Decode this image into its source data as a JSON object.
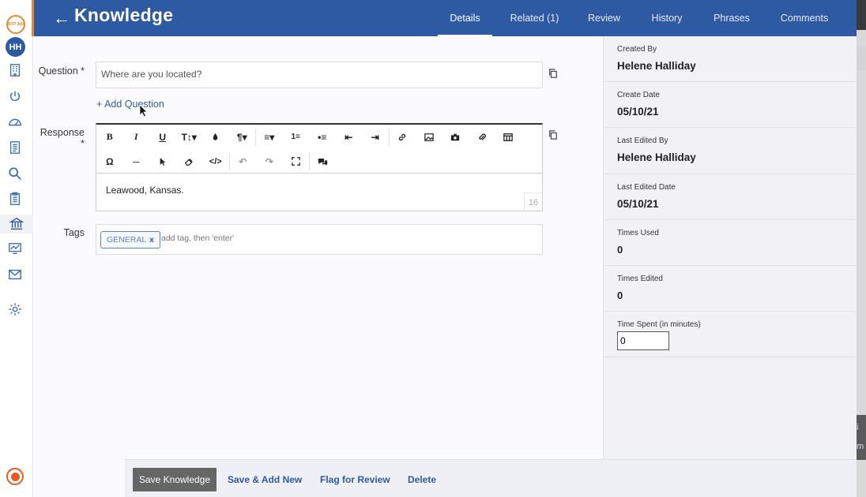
{
  "nav": {
    "brand_text": "BTP 360",
    "avatar_initials": "HH",
    "icons": [
      "building-icon",
      "power-icon",
      "dashboard-icon",
      "document-icon",
      "search-icon",
      "clipboard-icon",
      "bank-icon",
      "chart-monitor-icon",
      "mail-icon",
      "gear-icon"
    ]
  },
  "header": {
    "title": "Knowledge",
    "tabs": [
      {
        "label": "Details",
        "active": true
      },
      {
        "label": "Related (1)",
        "active": false
      },
      {
        "label": "Review",
        "active": false
      },
      {
        "label": "History",
        "active": false
      },
      {
        "label": "Phrases",
        "active": false
      },
      {
        "label": "Comments",
        "active": false
      }
    ]
  },
  "form": {
    "question_label": "Question *",
    "question_value": "Where are you located?",
    "add_question": "+ Add Question",
    "response_label": "Response *",
    "response_value": "Leawood, Kansas.",
    "response_char_count": "16",
    "tags_label": "Tags",
    "tags": [
      {
        "label": "GENERAL"
      }
    ],
    "tag_remove": "x",
    "tag_placeholder": "add tag, then 'enter'"
  },
  "toolbar": {
    "row1": [
      "bold-icon",
      "italic-icon",
      "underline-icon",
      "font-size-icon",
      "color-drop-icon",
      "paragraph-icon",
      "align-icon",
      "ordered-list-icon",
      "unordered-list-icon",
      "outdent-icon",
      "indent-icon",
      "link-icon",
      "image-icon",
      "camera-icon",
      "attachment-icon",
      "table-icon"
    ],
    "row2": [
      "special-char-icon",
      "horizontal-rule-icon",
      "pointer-icon",
      "eraser-icon",
      "code-view-icon",
      "undo-icon",
      "redo-icon",
      "fullscreen-icon",
      "comment-icon"
    ]
  },
  "sidebar": {
    "created_by_label": "Created By",
    "created_by": "Helene Halliday",
    "create_date_label": "Create Date",
    "create_date": "05/10/21",
    "last_edited_by_label": "Last Edited By",
    "last_edited_by": "Helene Halliday",
    "last_edited_date_label": "Last Edited Date",
    "last_edited_date": "05/10/21",
    "times_used_label": "Times Used",
    "times_used": "0",
    "times_edited_label": "Times Edited",
    "times_edited": "0",
    "time_spent_label": "Time Spent (in minutes)",
    "time_spent": "0"
  },
  "footer": {
    "save": "Save Knowledge",
    "save_add": "Save & Add New",
    "flag": "Flag for Review",
    "delete": "Delete"
  },
  "edge": {
    "letter1": "i",
    "letter2": "m"
  },
  "colors": {
    "header": "#2e5aa3",
    "accent": "#e8892a",
    "link": "#2e5aa3"
  }
}
